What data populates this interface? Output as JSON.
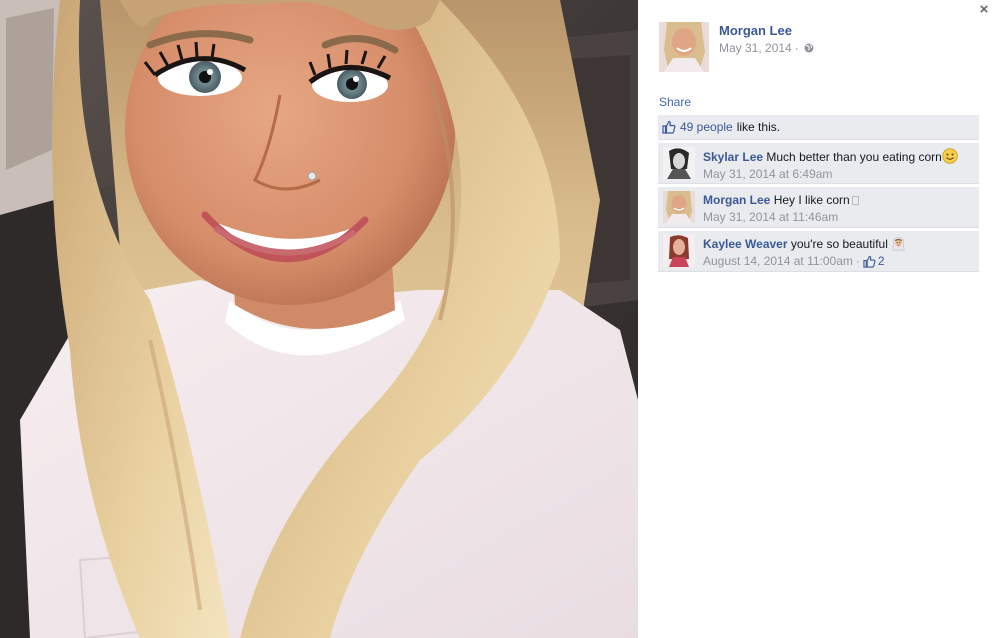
{
  "photo": {
    "alt": "Selfie of smiling woman with long blonde hair wearing a white t-shirt in a car"
  },
  "close": {
    "label": "×"
  },
  "post": {
    "author": "Morgan Lee",
    "date": "May 31, 2014",
    "separator": "·",
    "privacy_icon": "globe-icon",
    "share_label": "Share"
  },
  "likes": {
    "count_text": "49 people",
    "suffix": "like this."
  },
  "comments": [
    {
      "author": "Skylar Lee",
      "text": "Much better than you eating corn",
      "emoji": "smiley-face-emoji",
      "timestamp": "May 31, 2014 at 6:49am"
    },
    {
      "author": "Morgan Lee",
      "text": "Hey I like corn",
      "emoji": "missing-glyph-box",
      "timestamp": "May 31, 2014 at 11:46am"
    },
    {
      "author": "Kaylee Weaver",
      "text": "you're so beautiful",
      "emoji": "bride-emoji",
      "timestamp": "August 14, 2014 at 11:00am",
      "separator": "·",
      "like_count": "2"
    }
  ],
  "colors": {
    "link": "#3b5998",
    "meta": "#90949c",
    "ufi_bg": "#e9ebee",
    "share": "#4267b2"
  }
}
